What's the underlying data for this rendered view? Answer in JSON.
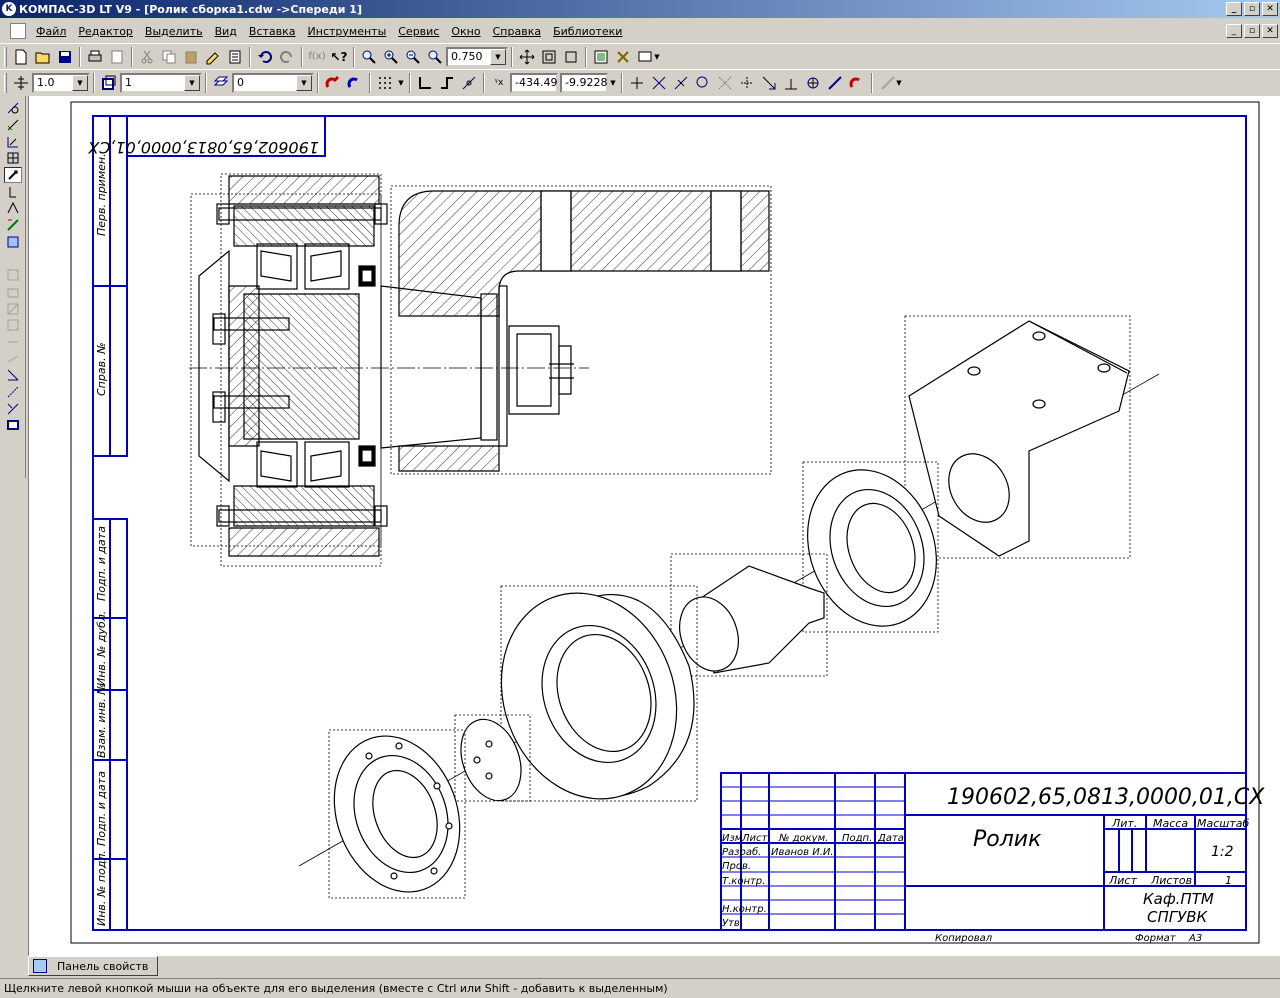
{
  "window": {
    "title": "КОМПАС-3D LT V9 - [Ролик сборка1.cdw ->Спереди 1]",
    "app_icon": "K"
  },
  "menu": [
    "Файл",
    "Редактор",
    "Выделить",
    "Вид",
    "Вставка",
    "Инструменты",
    "Сервис",
    "Окно",
    "Справка",
    "Библиотеки"
  ],
  "toolbar1": {
    "zoom_value": "0.750"
  },
  "toolbar2": {
    "step_value": "1.0",
    "layer_value": "1",
    "style_value": "0",
    "coord_x": "-434.49",
    "coord_y": "-9.9228"
  },
  "drawing": {
    "stamp_designation": "190602,65,0813,0000,01,CX",
    "designation_rotated": "190602,65,0813,0000,01,CX",
    "part_name": "Ролик",
    "scale": "1:2",
    "sheet_label": "Лист",
    "sheets_label": "Листов",
    "sheets_count": "1",
    "org_line1": "Каф.ПТМ",
    "org_line2": "СПГУВК",
    "lit_label": "Лит.",
    "mass_label": "Масса",
    "scale_label": "Масштаб",
    "copied_label": "Копировал",
    "format_label": "Формат",
    "format_value": "А3",
    "stamp_rows": [
      "Изм",
      "Лист",
      "№ докум.",
      "Подп.",
      "Дата"
    ],
    "role_razrab": "Разраб.",
    "role_prov": "Пров.",
    "role_tkontr": "Т.контр.",
    "role_nkontr": "Н.контр.",
    "role_utv": "Утв.",
    "author": "Иванов И.И.",
    "side_labels": [
      "Перв. примен.",
      "Справ. №",
      "Подп. и дата",
      "Инв. № дубл.",
      "Взам. инв. №",
      "Подп. и дата",
      "Инв. № подл."
    ]
  },
  "panel": {
    "tab_label": "Панель свойств"
  },
  "status": {
    "message": "Щелкните левой кнопкой мыши на объекте для его выделения (вместе с Ctrl или Shift - добавить к выделенным)"
  }
}
